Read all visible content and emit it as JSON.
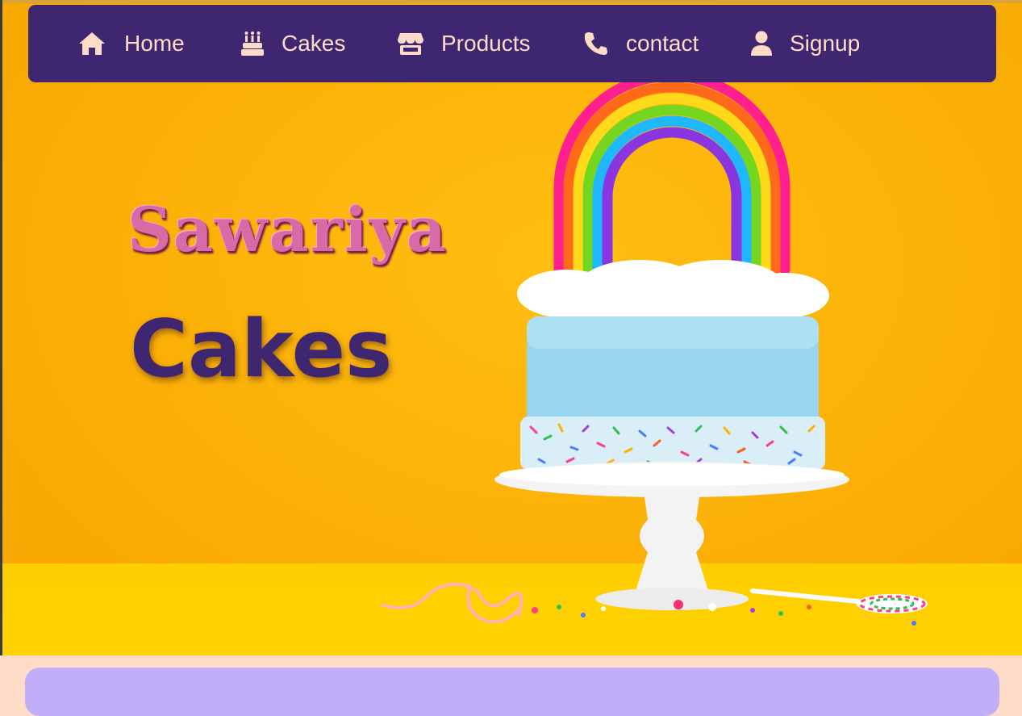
{
  "nav": {
    "items": [
      {
        "label": "Home",
        "icon": "home-icon"
      },
      {
        "label": "Cakes",
        "icon": "birthday-cake-icon"
      },
      {
        "label": "Products",
        "icon": "store-icon"
      },
      {
        "label": "contact",
        "icon": "phone-icon"
      },
      {
        "label": "Signup",
        "icon": "user-icon"
      }
    ]
  },
  "hero": {
    "brand": "Sawariya",
    "subtitle": "Cakes"
  },
  "colors": {
    "nav_bg": "#3f2670",
    "nav_text": "#ffdcc8",
    "hero_bg": "#fdb208",
    "panel": "#c0aef8"
  }
}
